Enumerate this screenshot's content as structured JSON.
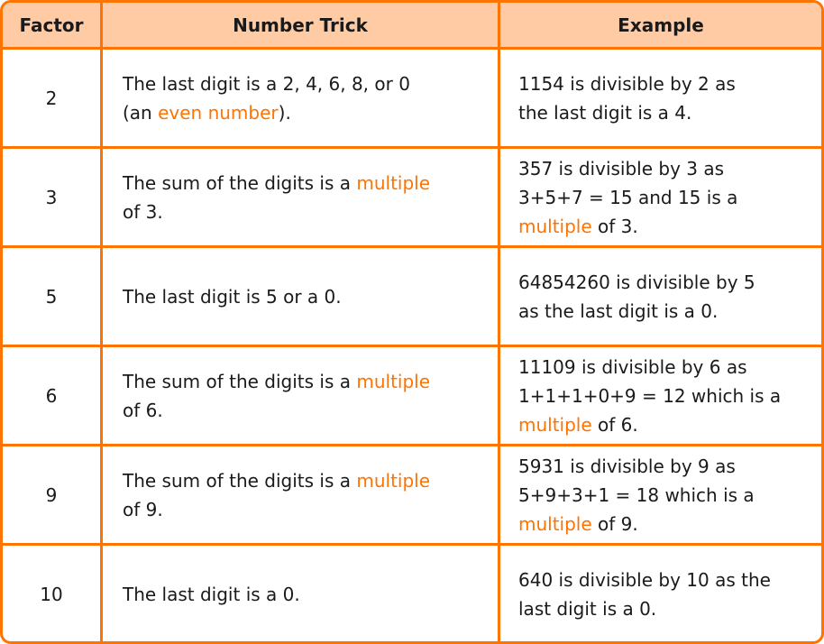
{
  "colors": {
    "border": "#FF7300",
    "header_bg": "#FFCBA4",
    "highlight": "#FF7300"
  },
  "headers": [
    "Factor",
    "Number Trick",
    "Example"
  ],
  "rows": [
    {
      "factor": "2",
      "trick": [
        [
          {
            "t": "The last digit is a 2, 4, 6, 8, or 0"
          }
        ],
        [
          {
            "t": "(an "
          },
          {
            "t": "even number",
            "hl": true
          },
          {
            "t": ")."
          }
        ]
      ],
      "example": [
        [
          {
            "t": "1154 is divisible by 2 as"
          }
        ],
        [
          {
            "t": "the last digit is a 4."
          }
        ]
      ]
    },
    {
      "factor": "3",
      "trick": [
        [
          {
            "t": "The sum of the digits is a "
          },
          {
            "t": "multiple",
            "hl": true
          }
        ],
        [
          {
            "t": "of 3."
          }
        ]
      ],
      "example": [
        [
          {
            "t": "357 is divisible by 3 as"
          }
        ],
        [
          {
            "t": "3+5+7 = 15 and 15 is a"
          }
        ],
        [
          {
            "t": "multiple",
            "hl": true
          },
          {
            "t": " of 3."
          }
        ]
      ]
    },
    {
      "factor": "5",
      "trick": [
        [
          {
            "t": "The last digit is 5 or a 0."
          }
        ]
      ],
      "example": [
        [
          {
            "t": "64854260 is divisible by 5"
          }
        ],
        [
          {
            "t": "as the last digit is a 0."
          }
        ]
      ]
    },
    {
      "factor": "6",
      "trick": [
        [
          {
            "t": "The sum of the digits is a "
          },
          {
            "t": "multiple",
            "hl": true
          }
        ],
        [
          {
            "t": "of 6."
          }
        ]
      ],
      "example": [
        [
          {
            "t": "11109 is divisible by 6 as"
          }
        ],
        [
          {
            "t": "1+1+1+0+9 = 12 which is a"
          }
        ],
        [
          {
            "t": "multiple",
            "hl": true
          },
          {
            "t": " of 6."
          }
        ]
      ]
    },
    {
      "factor": "9",
      "trick": [
        [
          {
            "t": "The sum of the digits is a "
          },
          {
            "t": "multiple",
            "hl": true
          }
        ],
        [
          {
            "t": "of 9."
          }
        ]
      ],
      "example": [
        [
          {
            "t": "5931 is divisible by 9 as"
          }
        ],
        [
          {
            "t": "5+9+3+1 = 18 which is a"
          }
        ],
        [
          {
            "t": "multiple",
            "hl": true
          },
          {
            "t": " of 9."
          }
        ]
      ]
    },
    {
      "factor": "10",
      "trick": [
        [
          {
            "t": "The last digit is a 0."
          }
        ]
      ],
      "example": [
        [
          {
            "t": "640 is divisible by 10 as the"
          }
        ],
        [
          {
            "t": "last digit is a 0."
          }
        ]
      ]
    }
  ]
}
